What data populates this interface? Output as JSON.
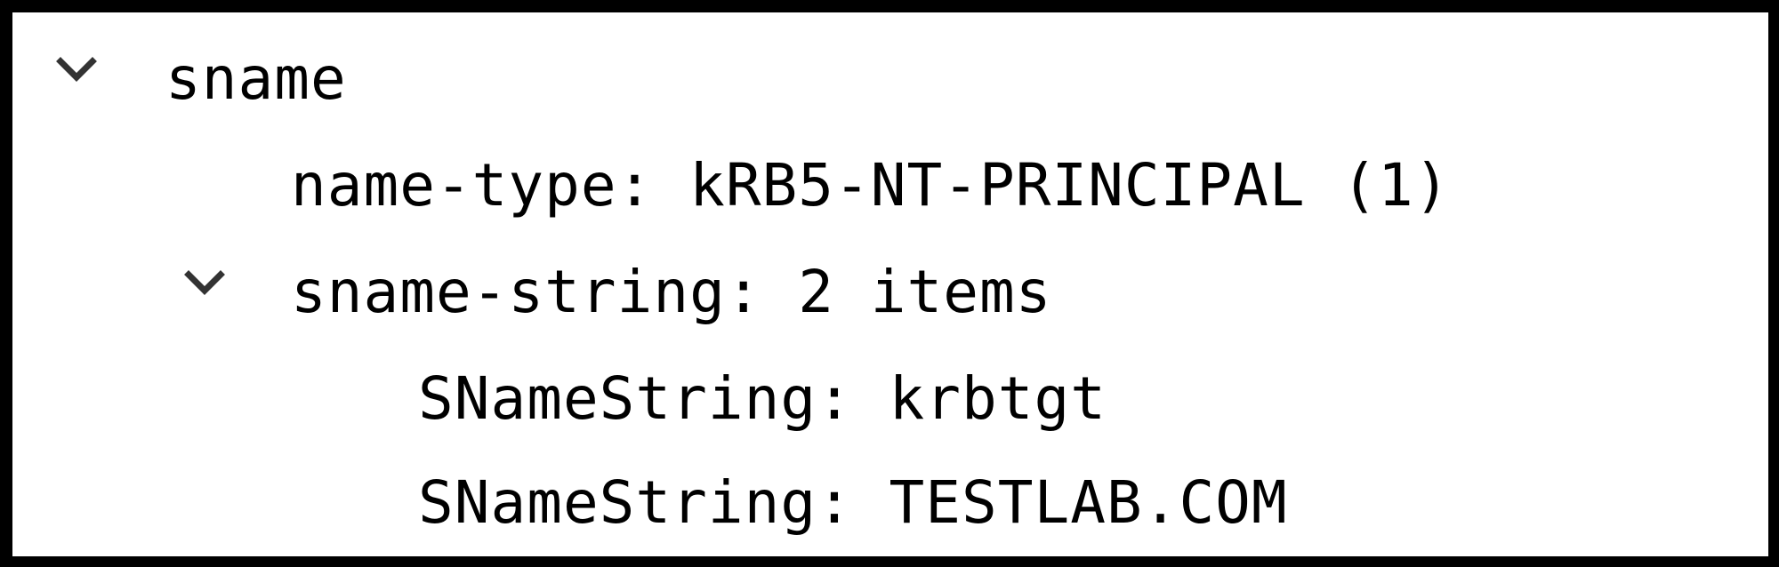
{
  "tree": {
    "nodes": [
      {
        "label": "sname",
        "expanded": true,
        "icon": "chevron-down-icon"
      },
      {
        "label": "name-type: kRB5-NT-PRINCIPAL (1)"
      },
      {
        "label": "sname-string: 2 items",
        "expanded": true,
        "icon": "chevron-down-icon"
      },
      {
        "label": "SNameString: krbtgt"
      },
      {
        "label": "SNameString: TESTLAB.COM"
      }
    ]
  },
  "colors": {
    "text": "#000000",
    "chevron": "#333333",
    "border": "#000000",
    "background": "#ffffff"
  }
}
